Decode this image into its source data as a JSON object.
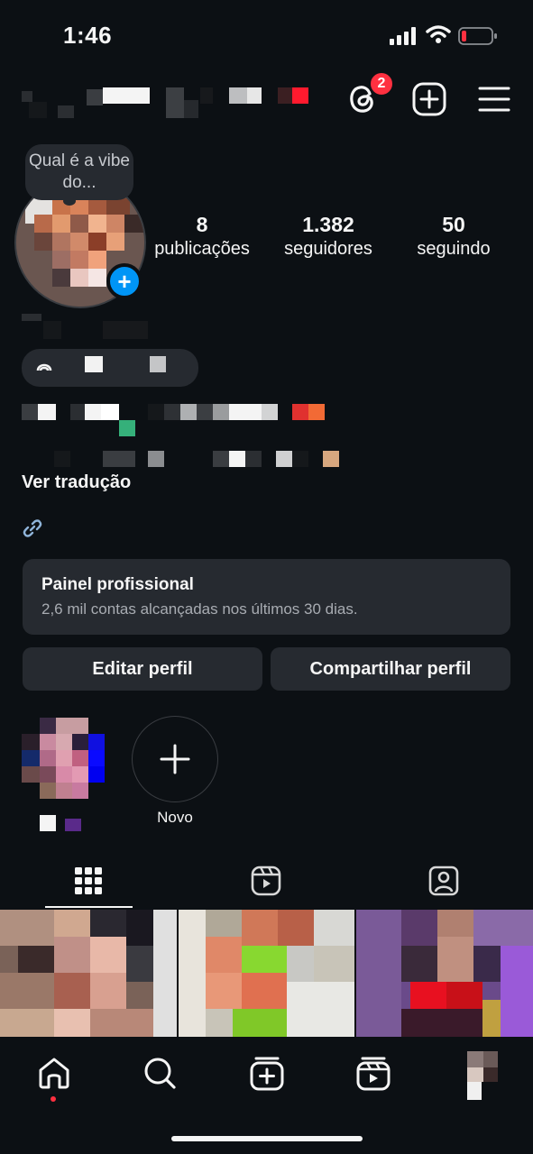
{
  "status_bar": {
    "time": "1:46"
  },
  "header": {
    "threads_badge": "2"
  },
  "note": {
    "text": "Qual é a vibe do..."
  },
  "stats": [
    {
      "value": "8",
      "label": "publicações"
    },
    {
      "value": "1.382",
      "label": "seguidores"
    },
    {
      "value": "50",
      "label": "seguindo"
    }
  ],
  "bio": {
    "translate_link": "Ver tradução"
  },
  "panel": {
    "title": "Painel profissional",
    "subtitle": "2,6 mil contas alcançadas nos últimos 30 dias."
  },
  "buttons": {
    "edit": "Editar perfil",
    "share": "Compartilhar perfil"
  },
  "highlights": {
    "new_label": "Novo"
  },
  "colors": {
    "background": "#0c1014",
    "surface": "#262a30",
    "accent": "#0095f6",
    "badge": "#ff3040"
  },
  "icons": {
    "header": [
      "threads-icon",
      "add-post-icon",
      "menu-icon"
    ],
    "tabs": [
      "grid-icon",
      "reels-icon",
      "tagged-icon"
    ],
    "nav": [
      "home-icon",
      "search-icon",
      "create-icon",
      "reels-icon",
      "profile-avatar"
    ]
  }
}
